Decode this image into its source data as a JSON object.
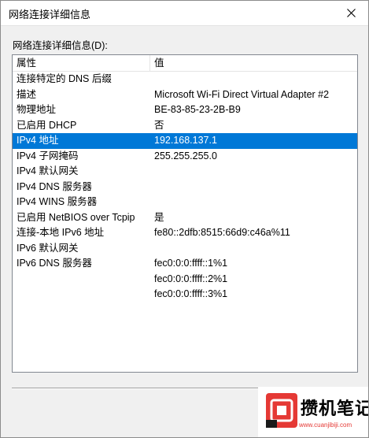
{
  "window": {
    "title": "网络连接详细信息"
  },
  "section_label": "网络连接详细信息(D):",
  "table": {
    "columns": [
      "属性",
      "值"
    ],
    "rows": [
      {
        "property": "连接特定的 DNS 后缀",
        "value": ""
      },
      {
        "property": "描述",
        "value": "Microsoft Wi-Fi Direct Virtual Adapter #2"
      },
      {
        "property": "物理地址",
        "value": "BE-83-85-23-2B-B9"
      },
      {
        "property": "已启用 DHCP",
        "value": "否"
      },
      {
        "property": "IPv4 地址",
        "value": "192.168.137.1",
        "selected": true
      },
      {
        "property": "IPv4 子网掩码",
        "value": "255.255.255.0"
      },
      {
        "property": "IPv4 默认网关",
        "value": ""
      },
      {
        "property": "IPv4 DNS 服务器",
        "value": ""
      },
      {
        "property": "IPv4 WINS 服务器",
        "value": ""
      },
      {
        "property": "已启用 NetBIOS over Tcpip",
        "value": "是"
      },
      {
        "property": "连接-本地 IPv6 地址",
        "value": "fe80::2dfb:8515:66d9:c46a%11"
      },
      {
        "property": "IPv6 默认网关",
        "value": ""
      },
      {
        "property": "IPv6 DNS 服务器",
        "value": "fec0:0:0:ffff::1%1"
      },
      {
        "property": "",
        "value": "fec0:0:0:ffff::2%1"
      },
      {
        "property": "",
        "value": "fec0:0:0:ffff::3%1"
      }
    ]
  },
  "watermark": {
    "title": "攒机笔记",
    "url": "www.cuanjibiji.com"
  },
  "colors": {
    "selection": "#0078d7",
    "watermark_red": "#e53935"
  },
  "icons": {
    "close": "close-icon"
  }
}
